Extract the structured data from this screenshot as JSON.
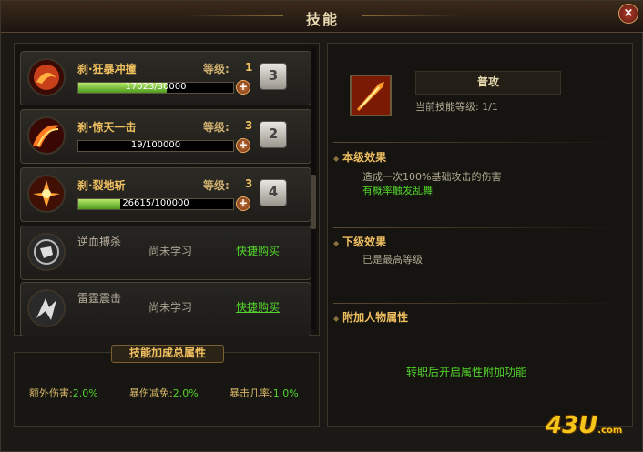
{
  "window": {
    "title": "技能",
    "close_label": "×"
  },
  "skills": [
    {
      "name": "刹·狂暴冲撞",
      "level_label": "等级:",
      "level": "1",
      "progress_text": "17023/30000",
      "progress": 0.57,
      "hotkey": "3",
      "plus_label": "+",
      "icon": "rage-charge-icon"
    },
    {
      "name": "刹·惊天一击",
      "level_label": "等级:",
      "level": "3",
      "progress_text": "19/100000",
      "progress": 0.0002,
      "hotkey": "2",
      "plus_label": "+",
      "icon": "slash-strike-icon"
    },
    {
      "name": "刹·裂地斩",
      "level_label": "等级:",
      "level": "3",
      "progress_text": "26615/100000",
      "progress": 0.27,
      "hotkey": "4",
      "plus_label": "+",
      "icon": "ground-split-icon"
    }
  ],
  "locked_skills": [
    {
      "name": "逆血搏杀",
      "status": "尚未学习",
      "buy_label": "快捷购买",
      "icon": "blood-fist-icon"
    },
    {
      "name": "雷霆震击",
      "status": "尚未学习",
      "buy_label": "快捷购买",
      "icon": "thunder-strike-icon"
    }
  ],
  "totals": {
    "title": "技能加成总属性",
    "stats": [
      {
        "label": "额外伤害:",
        "value": "2.0%"
      },
      {
        "label": "暴伤减免:",
        "value": "2.0%"
      },
      {
        "label": "暴击几率:",
        "value": "1.0%"
      }
    ]
  },
  "detail": {
    "name": "普攻",
    "level_text": "当前技能等级: 1/1",
    "current_head": "本级效果",
    "current_desc": "造成一次100%基础攻击的伤害",
    "current_extra": "有概率触发乱舞",
    "next_head": "下级效果",
    "next_desc": "已是最高等级",
    "attr_head": "附加人物属性",
    "footer": "转职后开启属性附加功能",
    "icon": "normal-attack-icon"
  },
  "logo": {
    "text": "43U",
    "suffix": ".com"
  },
  "colors": {
    "accent": "#f0c060",
    "green": "#52d22a",
    "background": "#1a1916"
  }
}
